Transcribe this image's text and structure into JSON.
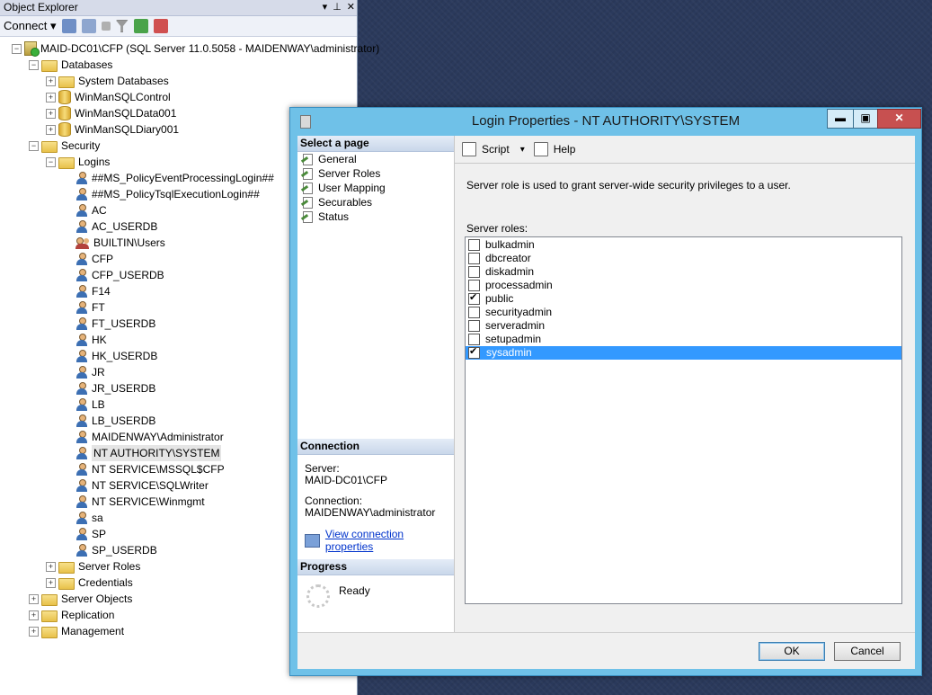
{
  "object_explorer": {
    "title": "Object Explorer",
    "pin_glyph": "▾ ⊥ ✕",
    "toolbar": {
      "connect_label": "Connect ▾"
    },
    "tree": [
      {
        "label": "MAID-DC01\\CFP (SQL Server 11.0.5058 - MAIDENWAY\\administrator)",
        "level": 0,
        "icon": "server-icon",
        "exp": "−"
      },
      {
        "label": "Databases",
        "level": 1,
        "icon": "folder-icon",
        "exp": "−"
      },
      {
        "label": "System Databases",
        "level": 2,
        "icon": "folder-icon",
        "exp": "+"
      },
      {
        "label": "WinManSQLControl",
        "level": 2,
        "icon": "database-icon",
        "exp": "+"
      },
      {
        "label": "WinManSQLData001",
        "level": 2,
        "icon": "database-icon",
        "exp": "+"
      },
      {
        "label": "WinManSQLDiary001",
        "level": 2,
        "icon": "database-icon",
        "exp": "+"
      },
      {
        "label": "Security",
        "level": 1,
        "icon": "folder-icon",
        "exp": "−"
      },
      {
        "label": "Logins",
        "level": 2,
        "icon": "folder-icon",
        "exp": "−"
      },
      {
        "label": "##MS_PolicyEventProcessingLogin##",
        "level": 3,
        "icon": "user-icon"
      },
      {
        "label": "##MS_PolicyTsqlExecutionLogin##",
        "level": 3,
        "icon": "user-icon"
      },
      {
        "label": "AC",
        "level": 3,
        "icon": "user-icon"
      },
      {
        "label": "AC_USERDB",
        "level": 3,
        "icon": "user-icon"
      },
      {
        "label": "BUILTIN\\Users",
        "level": 3,
        "icon": "group-icon"
      },
      {
        "label": "CFP",
        "level": 3,
        "icon": "user-icon"
      },
      {
        "label": "CFP_USERDB",
        "level": 3,
        "icon": "user-icon"
      },
      {
        "label": "F14",
        "level": 3,
        "icon": "user-icon"
      },
      {
        "label": "FT",
        "level": 3,
        "icon": "user-icon"
      },
      {
        "label": "FT_USERDB",
        "level": 3,
        "icon": "user-icon"
      },
      {
        "label": "HK",
        "level": 3,
        "icon": "user-icon"
      },
      {
        "label": "HK_USERDB",
        "level": 3,
        "icon": "user-icon"
      },
      {
        "label": "JR",
        "level": 3,
        "icon": "user-icon"
      },
      {
        "label": "JR_USERDB",
        "level": 3,
        "icon": "user-icon"
      },
      {
        "label": "LB",
        "level": 3,
        "icon": "user-icon"
      },
      {
        "label": "LB_USERDB",
        "level": 3,
        "icon": "user-icon"
      },
      {
        "label": "MAIDENWAY\\Administrator",
        "level": 3,
        "icon": "user-icon"
      },
      {
        "label": "NT AUTHORITY\\SYSTEM",
        "level": 3,
        "icon": "user-icon",
        "selected": true
      },
      {
        "label": "NT SERVICE\\MSSQL$CFP",
        "level": 3,
        "icon": "user-icon"
      },
      {
        "label": "NT SERVICE\\SQLWriter",
        "level": 3,
        "icon": "user-icon"
      },
      {
        "label": "NT SERVICE\\Winmgmt",
        "level": 3,
        "icon": "user-icon"
      },
      {
        "label": "sa",
        "level": 3,
        "icon": "user-icon"
      },
      {
        "label": "SP",
        "level": 3,
        "icon": "user-icon"
      },
      {
        "label": "SP_USERDB",
        "level": 3,
        "icon": "user-icon"
      },
      {
        "label": "Server Roles",
        "level": 2,
        "icon": "folder-icon",
        "exp": "+"
      },
      {
        "label": "Credentials",
        "level": 2,
        "icon": "folder-icon",
        "exp": "+"
      },
      {
        "label": "Server Objects",
        "level": 1,
        "icon": "folder-icon",
        "exp": "+"
      },
      {
        "label": "Replication",
        "level": 1,
        "icon": "folder-icon",
        "exp": "+"
      },
      {
        "label": "Management",
        "level": 1,
        "icon": "folder-icon",
        "exp": "+"
      }
    ]
  },
  "dialog": {
    "title": "Login Properties - NT AUTHORITY\\SYSTEM",
    "window_buttons": {
      "minimize": "▬",
      "maximize": "▣",
      "close": "✕"
    },
    "select_page": {
      "header": "Select a page",
      "items": [
        "General",
        "Server Roles",
        "User Mapping",
        "Securables",
        "Status"
      ]
    },
    "connection": {
      "header": "Connection",
      "server_label": "Server:",
      "server_value": "MAID-DC01\\CFP",
      "connection_label": "Connection:",
      "connection_value": "MAIDENWAY\\administrator",
      "view_link": "View connection properties"
    },
    "progress": {
      "header": "Progress",
      "status": "Ready"
    },
    "toolbar": {
      "script_label": "Script",
      "help_label": "Help",
      "dropdown_glyph": "▾"
    },
    "description": "Server role is used to grant server-wide security privileges to a user.",
    "roles_label": "Server roles:",
    "roles": [
      {
        "name": "bulkadmin",
        "checked": false
      },
      {
        "name": "dbcreator",
        "checked": false
      },
      {
        "name": "diskadmin",
        "checked": false
      },
      {
        "name": "processadmin",
        "checked": false
      },
      {
        "name": "public",
        "checked": true
      },
      {
        "name": "securityadmin",
        "checked": false
      },
      {
        "name": "serveradmin",
        "checked": false
      },
      {
        "name": "setupadmin",
        "checked": false
      },
      {
        "name": "sysadmin",
        "checked": true,
        "selected": true
      }
    ],
    "ok_label": "OK",
    "cancel_label": "Cancel"
  }
}
